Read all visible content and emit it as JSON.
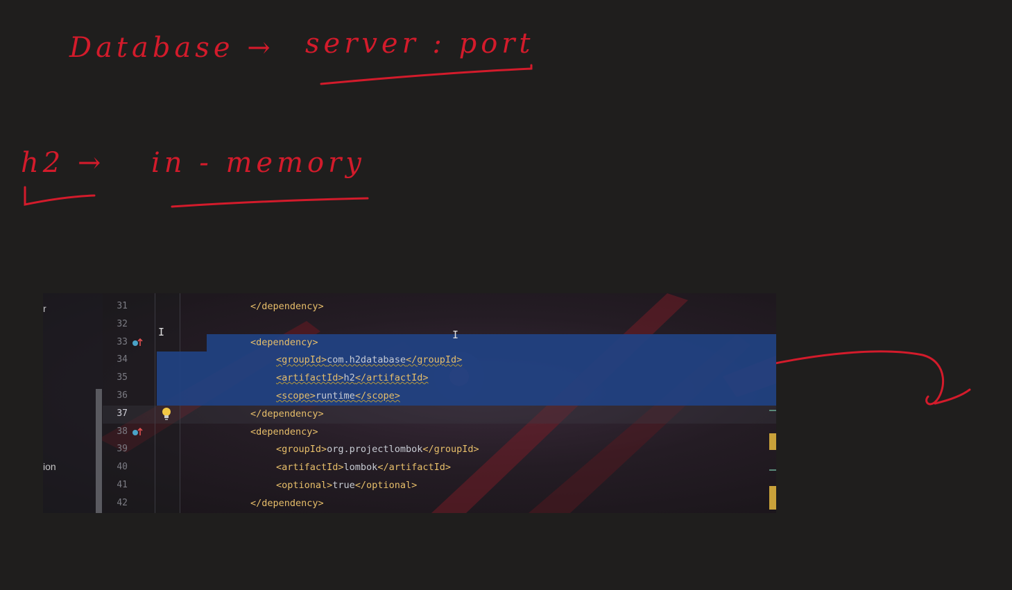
{
  "notes": {
    "line1_left": "Database →",
    "line1_right": "server : port",
    "line2_left": "h2 →",
    "line2_right": "in - memory"
  },
  "ide": {
    "project_strip": {
      "top_text": "r",
      "bottom_text": "ion"
    },
    "lines": [
      {
        "num": "31",
        "indent": 0,
        "parts": [
          [
            "tag",
            "</dependency>"
          ]
        ]
      },
      {
        "num": "32",
        "indent": 0,
        "parts": []
      },
      {
        "num": "33",
        "indent": 0,
        "parts": [
          [
            "tag",
            "<dependency>"
          ]
        ]
      },
      {
        "num": "34",
        "indent": 1,
        "parts": [
          [
            "tag",
            "<groupId>"
          ],
          [
            "txt",
            "com.h2database"
          ],
          [
            "tag",
            "</groupId>"
          ]
        ]
      },
      {
        "num": "35",
        "indent": 1,
        "parts": [
          [
            "tag",
            "<artifactId>"
          ],
          [
            "txt",
            "h2"
          ],
          [
            "tag",
            "</artifactId>"
          ]
        ]
      },
      {
        "num": "36",
        "indent": 1,
        "parts": [
          [
            "tag",
            "<scope>"
          ],
          [
            "txt",
            "runtime"
          ],
          [
            "tag",
            "</scope>"
          ]
        ]
      },
      {
        "num": "37",
        "indent": 0,
        "parts": [
          [
            "tag",
            "</dependency>"
          ]
        ]
      },
      {
        "num": "38",
        "indent": 0,
        "parts": [
          [
            "tag",
            "<dependency>"
          ]
        ]
      },
      {
        "num": "39",
        "indent": 1,
        "parts": [
          [
            "tag",
            "<groupId>"
          ],
          [
            "txt",
            "org.projectlombok"
          ],
          [
            "tag",
            "</groupId>"
          ]
        ]
      },
      {
        "num": "40",
        "indent": 1,
        "parts": [
          [
            "tag",
            "<artifactId>"
          ],
          [
            "txt",
            "lombok"
          ],
          [
            "tag",
            "</artifactId>"
          ]
        ]
      },
      {
        "num": "41",
        "indent": 1,
        "parts": [
          [
            "tag",
            "<optional>"
          ],
          [
            "txt",
            "true"
          ],
          [
            "tag",
            "</optional>"
          ]
        ]
      },
      {
        "num": "42",
        "indent": 0,
        "parts": [
          [
            "tag",
            "</dependency>"
          ]
        ]
      }
    ],
    "selected_lines": [
      "33",
      "34",
      "35",
      "36"
    ],
    "current_line": "37",
    "gutter_marker_lines": [
      "33",
      "38"
    ],
    "bulb_line": "37"
  },
  "colors": {
    "ink": "#d31b2b",
    "selection": "#214283",
    "tag": "#e8bf6a",
    "text": "#c8ccd4"
  }
}
